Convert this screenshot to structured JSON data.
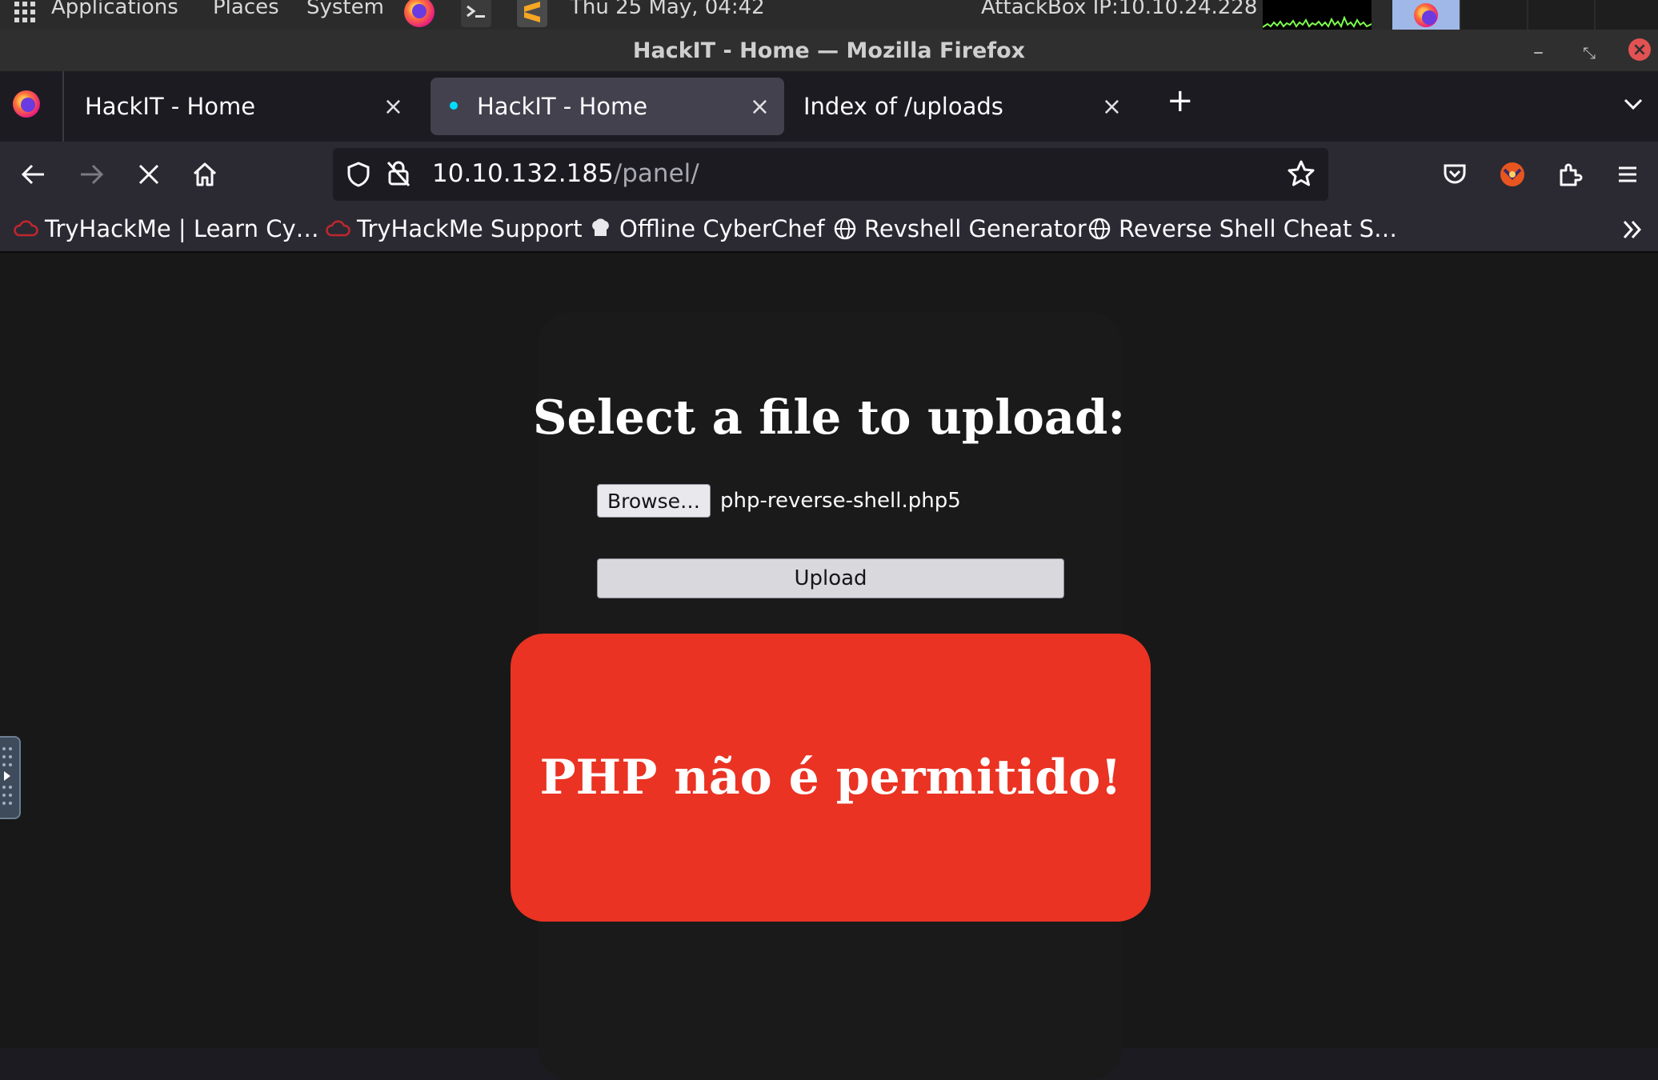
{
  "os_panel": {
    "applications": "Applications",
    "places": "Places",
    "system": "System",
    "datetime": "Thu 25 May, 04:42",
    "attackbox_ip": "AttackBox IP:10.10.24.228"
  },
  "window": {
    "title": "HackIT - Home — Mozilla Firefox"
  },
  "tabs": [
    {
      "title": "HackIT - Home",
      "active": false,
      "close": "×"
    },
    {
      "title": "HackIT - Home",
      "active": true,
      "close": "×",
      "loading": true
    },
    {
      "title": "Index of /uploads",
      "active": false,
      "close": "×"
    }
  ],
  "new_tab": "+",
  "urlbar": {
    "host": "10.10.132.185",
    "path": "/panel/"
  },
  "bookmarks": [
    {
      "label": "TryHackMe | Learn Cy…",
      "icon": "tryhackme-icon"
    },
    {
      "label": "TryHackMe Support",
      "icon": "tryhackme-icon"
    },
    {
      "label": "Offline CyberChef",
      "icon": "chef-hat-icon"
    },
    {
      "label": "Revshell Generator",
      "icon": "globe-icon"
    },
    {
      "label": "Reverse Shell Cheat S…",
      "icon": "globe-icon"
    }
  ],
  "page": {
    "heading": "Select a file to upload:",
    "browse_label": "Browse…",
    "selected_file": "php-reverse-shell.php5",
    "upload_label": "Upload",
    "error_message": "PHP não é permitido!"
  },
  "colors": {
    "error_box": "#ea3323",
    "page_bg": "#181818",
    "toolbar_bg": "#2b2a33",
    "tabbar_bg": "#1c1b22"
  }
}
